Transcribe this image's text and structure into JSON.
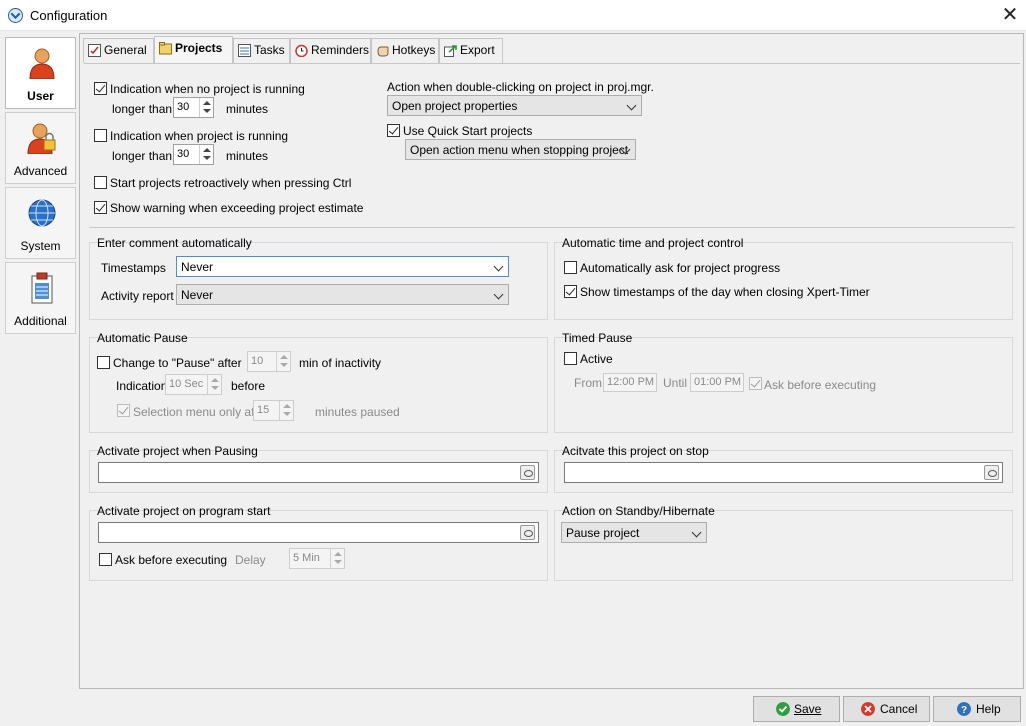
{
  "window": {
    "title": "Configuration"
  },
  "sidebar": {
    "items": [
      {
        "label": "User",
        "icon": "user-icon"
      },
      {
        "label": "Advanced",
        "icon": "advanced-user-icon"
      },
      {
        "label": "System",
        "icon": "globe-icon"
      },
      {
        "label": "Additional",
        "icon": "clipboard-icon"
      }
    ]
  },
  "tabs": [
    {
      "label": "General",
      "icon": "general-icon"
    },
    {
      "label": "Projects",
      "icon": "projects-icon"
    },
    {
      "label": "Tasks",
      "icon": "tasks-icon"
    },
    {
      "label": "Reminders",
      "icon": "alarm-icon"
    },
    {
      "label": "Hotkeys",
      "icon": "hand-icon"
    },
    {
      "label": "Export",
      "icon": "export-icon"
    }
  ],
  "top": {
    "ind_no_project": {
      "label": "Indication when no project is running",
      "checked": true
    },
    "ind_no_project_longer": "longer than",
    "ind_no_project_value": "30",
    "ind_no_project_unit": "minutes",
    "ind_project": {
      "label": "Indication when project is running",
      "checked": false
    },
    "ind_project_longer": "longer than",
    "ind_project_value": "30",
    "ind_project_unit": "minutes",
    "retroactive": {
      "label": "Start projects retroactively when pressing Ctrl",
      "checked": false
    },
    "warning": {
      "label": "Show warning when exceeding project estimate",
      "checked": true
    },
    "dblclick_label": "Action when double-clicking on project in proj.mgr.",
    "dblclick_value": "Open project properties",
    "quick_start": {
      "label": "Use Quick Start projects",
      "checked": true
    },
    "quick_start_value": "Open action menu when stopping project"
  },
  "comment": {
    "title": "Enter comment automatically",
    "timestamps_label": "Timestamps",
    "timestamps_value": "Never",
    "activity_label": "Activity report",
    "activity_value": "Never"
  },
  "auto_control": {
    "title": "Automatic time and project control",
    "ask_progress": {
      "label": "Automatically ask for project progress",
      "checked": false
    },
    "show_timestamps": {
      "label": "Show timestamps of the day when closing Xpert-Timer",
      "checked": true
    }
  },
  "auto_pause": {
    "title": "Automatic Pause",
    "change": {
      "label": "Change to \"Pause\" after",
      "checked": false
    },
    "minutes_value": "10",
    "minutes_label": "min of inactivity",
    "indication_label": "Indication",
    "indication_value": "10 Sec",
    "before_label": "before",
    "selection": {
      "label": "Selection menu only after",
      "checked": true
    },
    "paused_value": "15",
    "paused_label": "minutes paused"
  },
  "timed_pause": {
    "title": "Timed Pause",
    "active": {
      "label": "Active",
      "checked": false
    },
    "from_label": "From",
    "from_value": "12:00 PM",
    "until_label": "Until",
    "until_value": "01:00 PM",
    "ask": {
      "label": "Ask before executing",
      "checked": true
    }
  },
  "pausing": {
    "title": "Activate project when Pausing"
  },
  "stop": {
    "title": "Acitvate this project on stop"
  },
  "program_start": {
    "title": "Activate project on program start",
    "ask": {
      "label": "Ask before executing",
      "checked": false
    },
    "delay_label": "Delay",
    "delay_value": "5 Min"
  },
  "standby": {
    "title": "Action on Standby/Hibernate",
    "value": "Pause project"
  },
  "buttons": {
    "save": "Save",
    "cancel": "Cancel",
    "help": "Help"
  }
}
